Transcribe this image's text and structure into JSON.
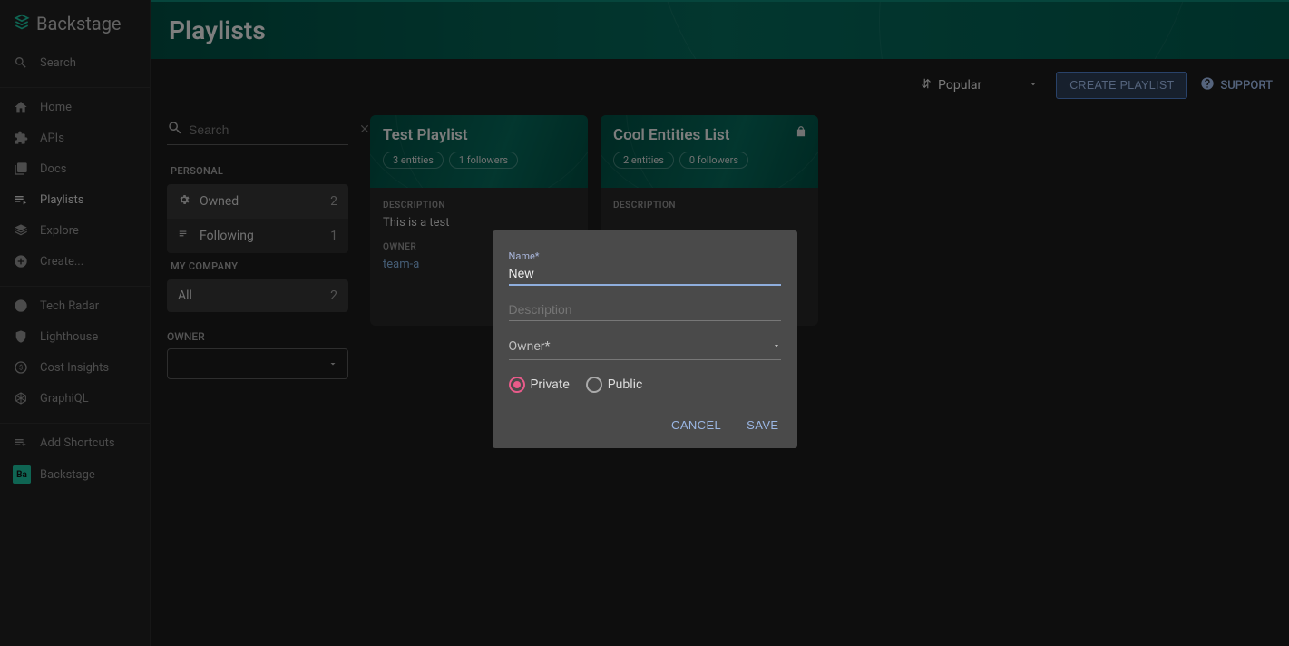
{
  "app": {
    "name": "Backstage",
    "page_title": "Playlists"
  },
  "sidebar": {
    "search_label": "Search",
    "nav": [
      {
        "label": "Home",
        "icon": "home-icon"
      },
      {
        "label": "APIs",
        "icon": "puzzle-icon"
      },
      {
        "label": "Docs",
        "icon": "docs-icon"
      },
      {
        "label": "Playlists",
        "icon": "playlist-icon",
        "active": true
      },
      {
        "label": "Explore",
        "icon": "layers-icon"
      },
      {
        "label": "Create...",
        "icon": "add-icon"
      }
    ],
    "tools": [
      {
        "label": "Tech Radar",
        "icon": "radar-icon"
      },
      {
        "label": "Lighthouse",
        "icon": "shield-icon"
      },
      {
        "label": "Cost Insights",
        "icon": "money-icon"
      },
      {
        "label": "GraphiQL",
        "icon": "graphql-icon"
      }
    ],
    "add_shortcuts": "Add Shortcuts",
    "shortcut": {
      "badge": "Ba",
      "label": "Backstage"
    }
  },
  "toolbar": {
    "sort_label": "Popular",
    "create_label": "CREATE PLAYLIST",
    "support_label": "SUPPORT"
  },
  "filters": {
    "search_placeholder": "Search",
    "sections": {
      "personal_label": "PERSONAL",
      "personal": [
        {
          "icon": "gear-icon",
          "label": "Owned",
          "count": "2",
          "selected": true
        },
        {
          "icon": "list-icon",
          "label": "Following",
          "count": "1"
        }
      ],
      "company_label": "MY COMPANY",
      "company": [
        {
          "label": "All",
          "count": "2",
          "selected": true
        }
      ]
    },
    "owner_label": "OWNER"
  },
  "playlists": [
    {
      "title": "Test Playlist",
      "entities": "3 entities",
      "followers": "1 followers",
      "desc_label": "DESCRIPTION",
      "description": "This is a test",
      "owner_label": "OWNER",
      "owner": "team-a",
      "locked": false
    },
    {
      "title": "Cool Entities List",
      "entities": "2 entities",
      "followers": "0 followers",
      "desc_label": "DESCRIPTION",
      "description": "",
      "owner_label": "",
      "owner": "",
      "locked": true
    }
  ],
  "dialog": {
    "name_label": "Name*",
    "name_value": "New ",
    "description_label": "Description",
    "owner_label": "Owner*",
    "private_label": "Private",
    "public_label": "Public",
    "visibility": "private",
    "cancel": "CANCEL",
    "save": "SAVE"
  }
}
